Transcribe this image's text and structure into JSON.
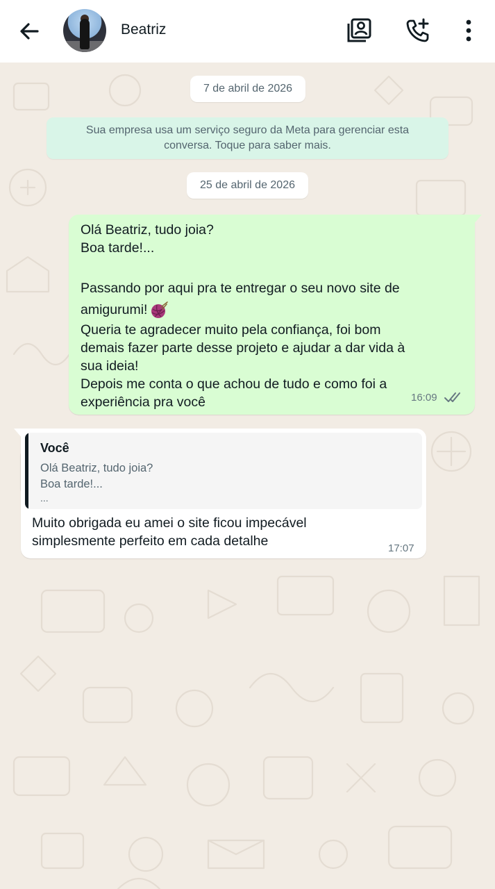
{
  "header": {
    "contact_name": "Beatriz",
    "icons": [
      "back-arrow-icon",
      "contact-avatar",
      "add-to-contacts-icon",
      "add-call-icon",
      "more-options-icon"
    ]
  },
  "chat": {
    "date_chip_1": "7 de abril de 2026",
    "system_note": {
      "line1": "Sua empresa usa um serviço seguro da Meta para gerenciar esta",
      "line2": "conversa. Toque para saber mais."
    },
    "date_chip_2": "25 de abril de 2026",
    "outgoing_message": {
      "lines": [
        "Olá Beatriz, tudo joia?",
        "Boa tarde!...",
        "",
        "Passando por aqui pra te entregar o seu novo site de",
        "amigurumi!",
        "Queria te agradecer muito pela confiança, foi bom",
        "demais fazer parte desse projeto e ajudar a dar vida à",
        "sua ideia!",
        "Depois me conta o que achou de tudo e como foi a",
        "experiência pra você"
      ],
      "emoji": "yarn-ball-emoji",
      "time": "16:09",
      "status": "delivered"
    },
    "incoming_message": {
      "quote": {
        "author": "Você",
        "line1": "Olá Beatriz, tudo joia?",
        "line2": "Boa tarde!...",
        "line3": "..."
      },
      "lines": [
        "Muito obrigada eu amei o site ficou impecável",
        "simplesmente perfeito em cada detalhe"
      ],
      "time": "17:07"
    }
  },
  "colors": {
    "wallpaper": "#f2ece4",
    "outgoing_bubble": "#d9fdd3",
    "incoming_bubble": "#ffffff",
    "system_note": "#d9f5e8",
    "meta_text": "#667781"
  }
}
